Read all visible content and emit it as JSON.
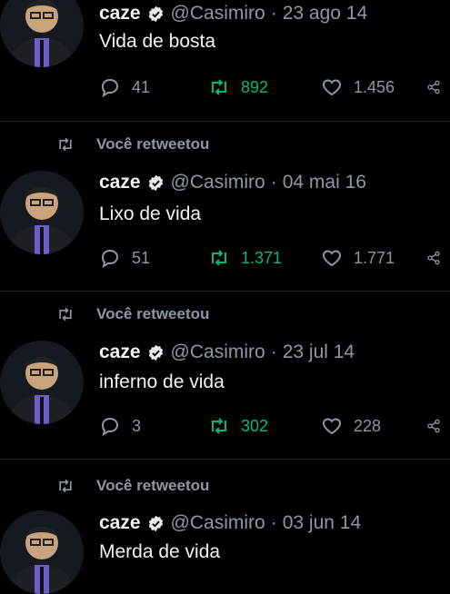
{
  "retweet_label": "Você retweetou",
  "tweets": [
    {
      "name": "caze",
      "handle": "@Casimiro",
      "separator": "·",
      "date": "23 ago 14",
      "text": "Vida de bosta",
      "replies": "41",
      "retweets": "892",
      "likes": "1.456",
      "retweeted_by_you": false
    },
    {
      "name": "caze",
      "handle": "@Casimiro",
      "separator": "·",
      "date": "04 mai 16",
      "text": "Lixo de vida",
      "replies": "51",
      "retweets": "1.371",
      "likes": "1.771",
      "retweeted_by_you": true
    },
    {
      "name": "caze",
      "handle": "@Casimiro",
      "separator": "·",
      "date": "23 jul 14",
      "text": "inferno de vida",
      "replies": "3",
      "retweets": "302",
      "likes": "228",
      "retweeted_by_you": true
    },
    {
      "name": "caze",
      "handle": "@Casimiro",
      "separator": "·",
      "date": "03 jun 14",
      "text": "Merda de vida",
      "retweeted_by_you": true
    }
  ],
  "colors": {
    "background": "#000000",
    "text": "#e7e9ea",
    "muted": "#8b98a5",
    "retweet_green": "#00ba7c",
    "verified": "#e7e9ea"
  }
}
